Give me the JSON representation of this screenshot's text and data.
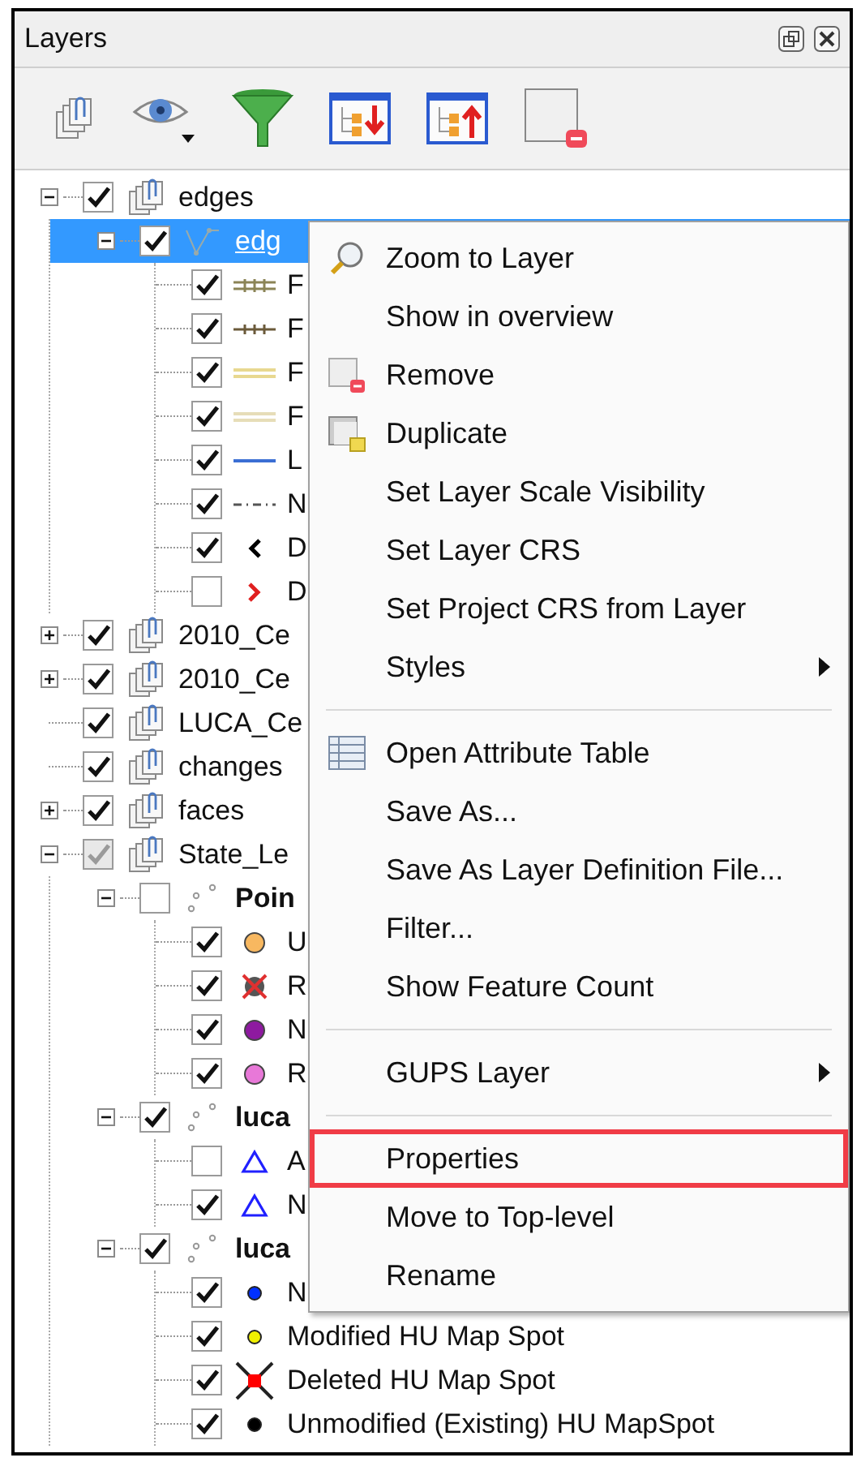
{
  "panel": {
    "title": "Layers"
  },
  "tree": [
    {
      "label": "edges",
      "kind": "group",
      "checked": true,
      "partial": false,
      "selected": false,
      "expanded": true,
      "children": [
        {
          "label": "edg",
          "kind": "line-layer",
          "checked": true,
          "partial": false,
          "selected": true,
          "expanded": true,
          "children": [
            {
              "label": "F",
              "kind": "ticked-double-line",
              "color": "#8b8456",
              "checked": true,
              "partial": false,
              "selected": false
            },
            {
              "label": "F",
              "kind": "ticked-line",
              "color": "#6b5a3a",
              "checked": true,
              "partial": false,
              "selected": false
            },
            {
              "label": "F",
              "kind": "double-line",
              "color": "#e8d890",
              "checked": true,
              "partial": false,
              "selected": false
            },
            {
              "label": "F",
              "kind": "double-line",
              "color": "#e6ddb8",
              "checked": true,
              "partial": false,
              "selected": false
            },
            {
              "label": "L",
              "kind": "line",
              "color": "#3b6fd4",
              "checked": true,
              "partial": false,
              "selected": false
            },
            {
              "label": "N",
              "kind": "dash-dot",
              "color": "#555555",
              "checked": true,
              "partial": false,
              "selected": false
            },
            {
              "label": "D",
              "kind": "chevron-left",
              "color": "#000000",
              "checked": true,
              "partial": false,
              "selected": false
            },
            {
              "label": "D",
              "kind": "chevron-right",
              "color": "#e02020",
              "checked": false,
              "partial": false,
              "selected": false
            }
          ]
        }
      ]
    },
    {
      "label": "2010_Ce",
      "kind": "group",
      "checked": true,
      "partial": false,
      "selected": false,
      "expanded": false
    },
    {
      "label": "2010_Ce",
      "kind": "group",
      "checked": true,
      "partial": false,
      "selected": false,
      "expanded": false
    },
    {
      "label": "LUCA_Ce",
      "kind": "group",
      "checked": true,
      "partial": false,
      "selected": false
    },
    {
      "label": "changes",
      "kind": "group",
      "checked": true,
      "partial": false,
      "selected": false
    },
    {
      "label": "faces",
      "kind": "group",
      "checked": true,
      "partial": false,
      "selected": false,
      "expanded": false
    },
    {
      "label": "State_Le",
      "kind": "group",
      "checked": true,
      "partial": true,
      "selected": false,
      "expanded": true,
      "children": [
        {
          "label": "Poin",
          "kind": "point-category",
          "checked": false,
          "partial": false,
          "selected": false,
          "expanded": true,
          "children": [
            {
              "label": "U",
              "kind": "circle",
              "color": "#f8b860",
              "checked": true,
              "partial": false,
              "selected": false
            },
            {
              "label": "R",
              "kind": "crossed-circle",
              "color": "#555555",
              "checked": true,
              "partial": false,
              "selected": false
            },
            {
              "label": "N",
              "kind": "circle",
              "color": "#8e1aa0",
              "checked": true,
              "partial": false,
              "selected": false
            },
            {
              "label": "R",
              "kind": "circle",
              "color": "#e878d8",
              "checked": true,
              "partial": false,
              "selected": false
            }
          ]
        },
        {
          "label": "luca",
          "kind": "point-category",
          "checked": true,
          "partial": false,
          "selected": false,
          "expanded": true,
          "children": [
            {
              "label": "A",
              "kind": "triangle",
              "color": "#2020ff",
              "checked": false,
              "partial": false,
              "selected": false
            },
            {
              "label": "N",
              "kind": "triangle",
              "color": "#2020ff",
              "checked": true,
              "partial": false,
              "selected": false
            }
          ]
        },
        {
          "label": "luca",
          "kind": "point-category",
          "checked": true,
          "partial": false,
          "selected": false,
          "expanded": true,
          "children": [
            {
              "label": "N",
              "kind": "dot",
              "color": "#0030ff",
              "checked": true,
              "partial": false,
              "selected": false
            },
            {
              "label": "Modified HU Map Spot",
              "kind": "dot",
              "color": "#f0f000",
              "checked": true,
              "partial": false,
              "selected": false
            },
            {
              "label": "Deleted HU Map Spot",
              "kind": "cross",
              "color": "#ff0000",
              "checked": true,
              "partial": false,
              "selected": false
            },
            {
              "label": "Unmodified (Existing) HU MapSpot",
              "kind": "dot",
              "color": "#000000",
              "checked": true,
              "partial": false,
              "selected": false
            }
          ]
        }
      ]
    }
  ],
  "context_menu": [
    {
      "kind": "item",
      "label": "Zoom to Layer",
      "submenu": false,
      "highlighted": false
    },
    {
      "kind": "item",
      "label": "Show in overview",
      "submenu": false,
      "highlighted": false
    },
    {
      "kind": "item",
      "label": "Remove",
      "submenu": false,
      "highlighted": false
    },
    {
      "kind": "item",
      "label": "Duplicate",
      "submenu": false,
      "highlighted": false
    },
    {
      "kind": "item",
      "label": "Set Layer Scale Visibility",
      "submenu": false,
      "highlighted": false
    },
    {
      "kind": "item",
      "label": "Set Layer CRS",
      "submenu": false,
      "highlighted": false
    },
    {
      "kind": "item",
      "label": "Set Project CRS from Layer",
      "submenu": false,
      "highlighted": false
    },
    {
      "kind": "item",
      "label": "Styles",
      "submenu": true,
      "highlighted": false
    },
    {
      "kind": "separator"
    },
    {
      "kind": "item",
      "label": "Open Attribute Table",
      "submenu": false,
      "highlighted": false
    },
    {
      "kind": "item",
      "label": "Save As...",
      "submenu": false,
      "highlighted": false
    },
    {
      "kind": "item",
      "label": "Save As Layer Definition File...",
      "submenu": false,
      "highlighted": false
    },
    {
      "kind": "item",
      "label": "Filter...",
      "submenu": false,
      "highlighted": false
    },
    {
      "kind": "item",
      "label": "Show Feature Count",
      "submenu": false,
      "highlighted": false
    },
    {
      "kind": "separator"
    },
    {
      "kind": "item",
      "label": "GUPS Layer",
      "submenu": true,
      "highlighted": false
    },
    {
      "kind": "separator"
    },
    {
      "kind": "item",
      "label": "Properties",
      "submenu": false,
      "highlighted": true
    },
    {
      "kind": "item",
      "label": "Move to Top-level",
      "submenu": false,
      "highlighted": false
    },
    {
      "kind": "item",
      "label": "Rename",
      "submenu": false,
      "highlighted": false
    }
  ]
}
